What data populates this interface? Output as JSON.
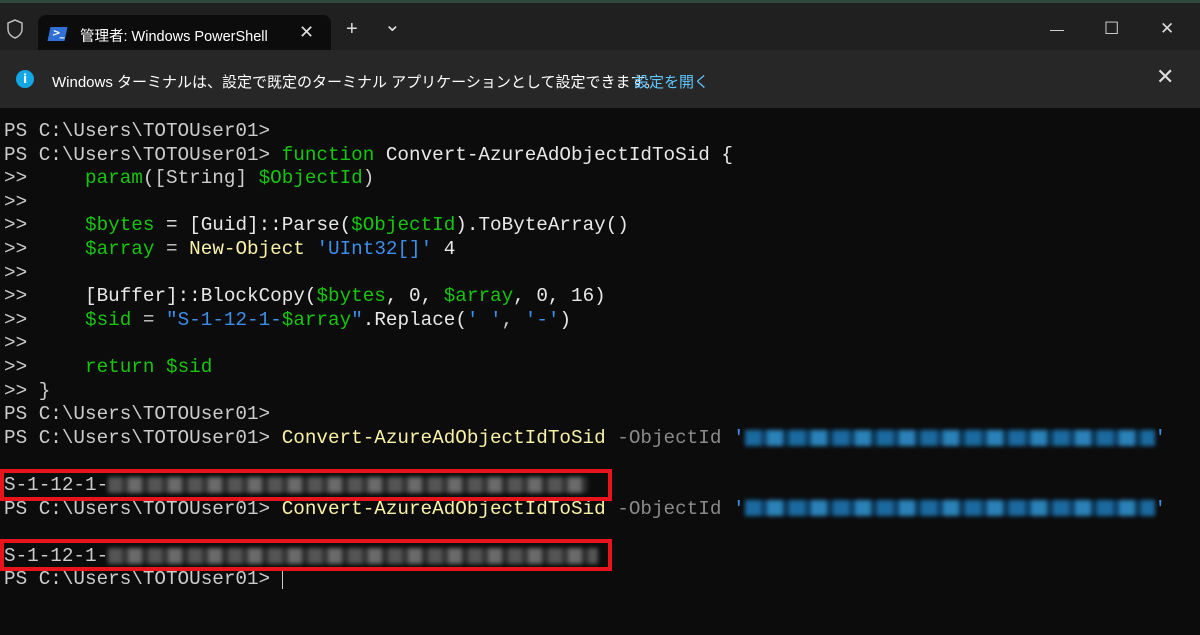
{
  "window": {
    "tab_title": "管理者: Windows PowerShell",
    "new_tab": "+",
    "dropdown": "⌄",
    "minimize": "—",
    "maximize": "☐",
    "close": "✕",
    "tab_close": "✕"
  },
  "banner": {
    "message": "Windows ターミナルは、設定で既定のターミナル アプリケーションとして設定できます。",
    "link": "設定を開く",
    "close": "✕"
  },
  "terminal": {
    "prompt": "PS C:\\Users\\TOTOUser01> ",
    "cont": ">> ",
    "l2": [
      "function",
      "Convert-AzureAdObjectIdToSid {"
    ],
    "l3": [
      "param",
      "([String] ",
      "$ObjectId",
      ")"
    ],
    "l5": [
      "$bytes",
      " = [Guid]::Parse(",
      "$ObjectId",
      ").ToByteArray()"
    ],
    "l6": [
      "$array",
      " = ",
      "New-Object",
      " ",
      "'UInt32[]'",
      " 4"
    ],
    "l8": [
      "[Buffer]::BlockCopy(",
      "$bytes",
      ", 0, ",
      "$array",
      ", 0, 16)"
    ],
    "l9": [
      "$sid",
      " = ",
      "\"S-1-12-1-",
      "$array",
      "\"",
      ".Replace(",
      "' '",
      ", ",
      "'-'",
      ")"
    ],
    "l11": [
      "return",
      " ",
      "$sid"
    ],
    "l12": "}",
    "cmd": "Convert-AzureAdObjectIdToSid",
    "param": " -ObjectId ",
    "quote": "'",
    "sid_prefix": "S-1-12-1-"
  }
}
